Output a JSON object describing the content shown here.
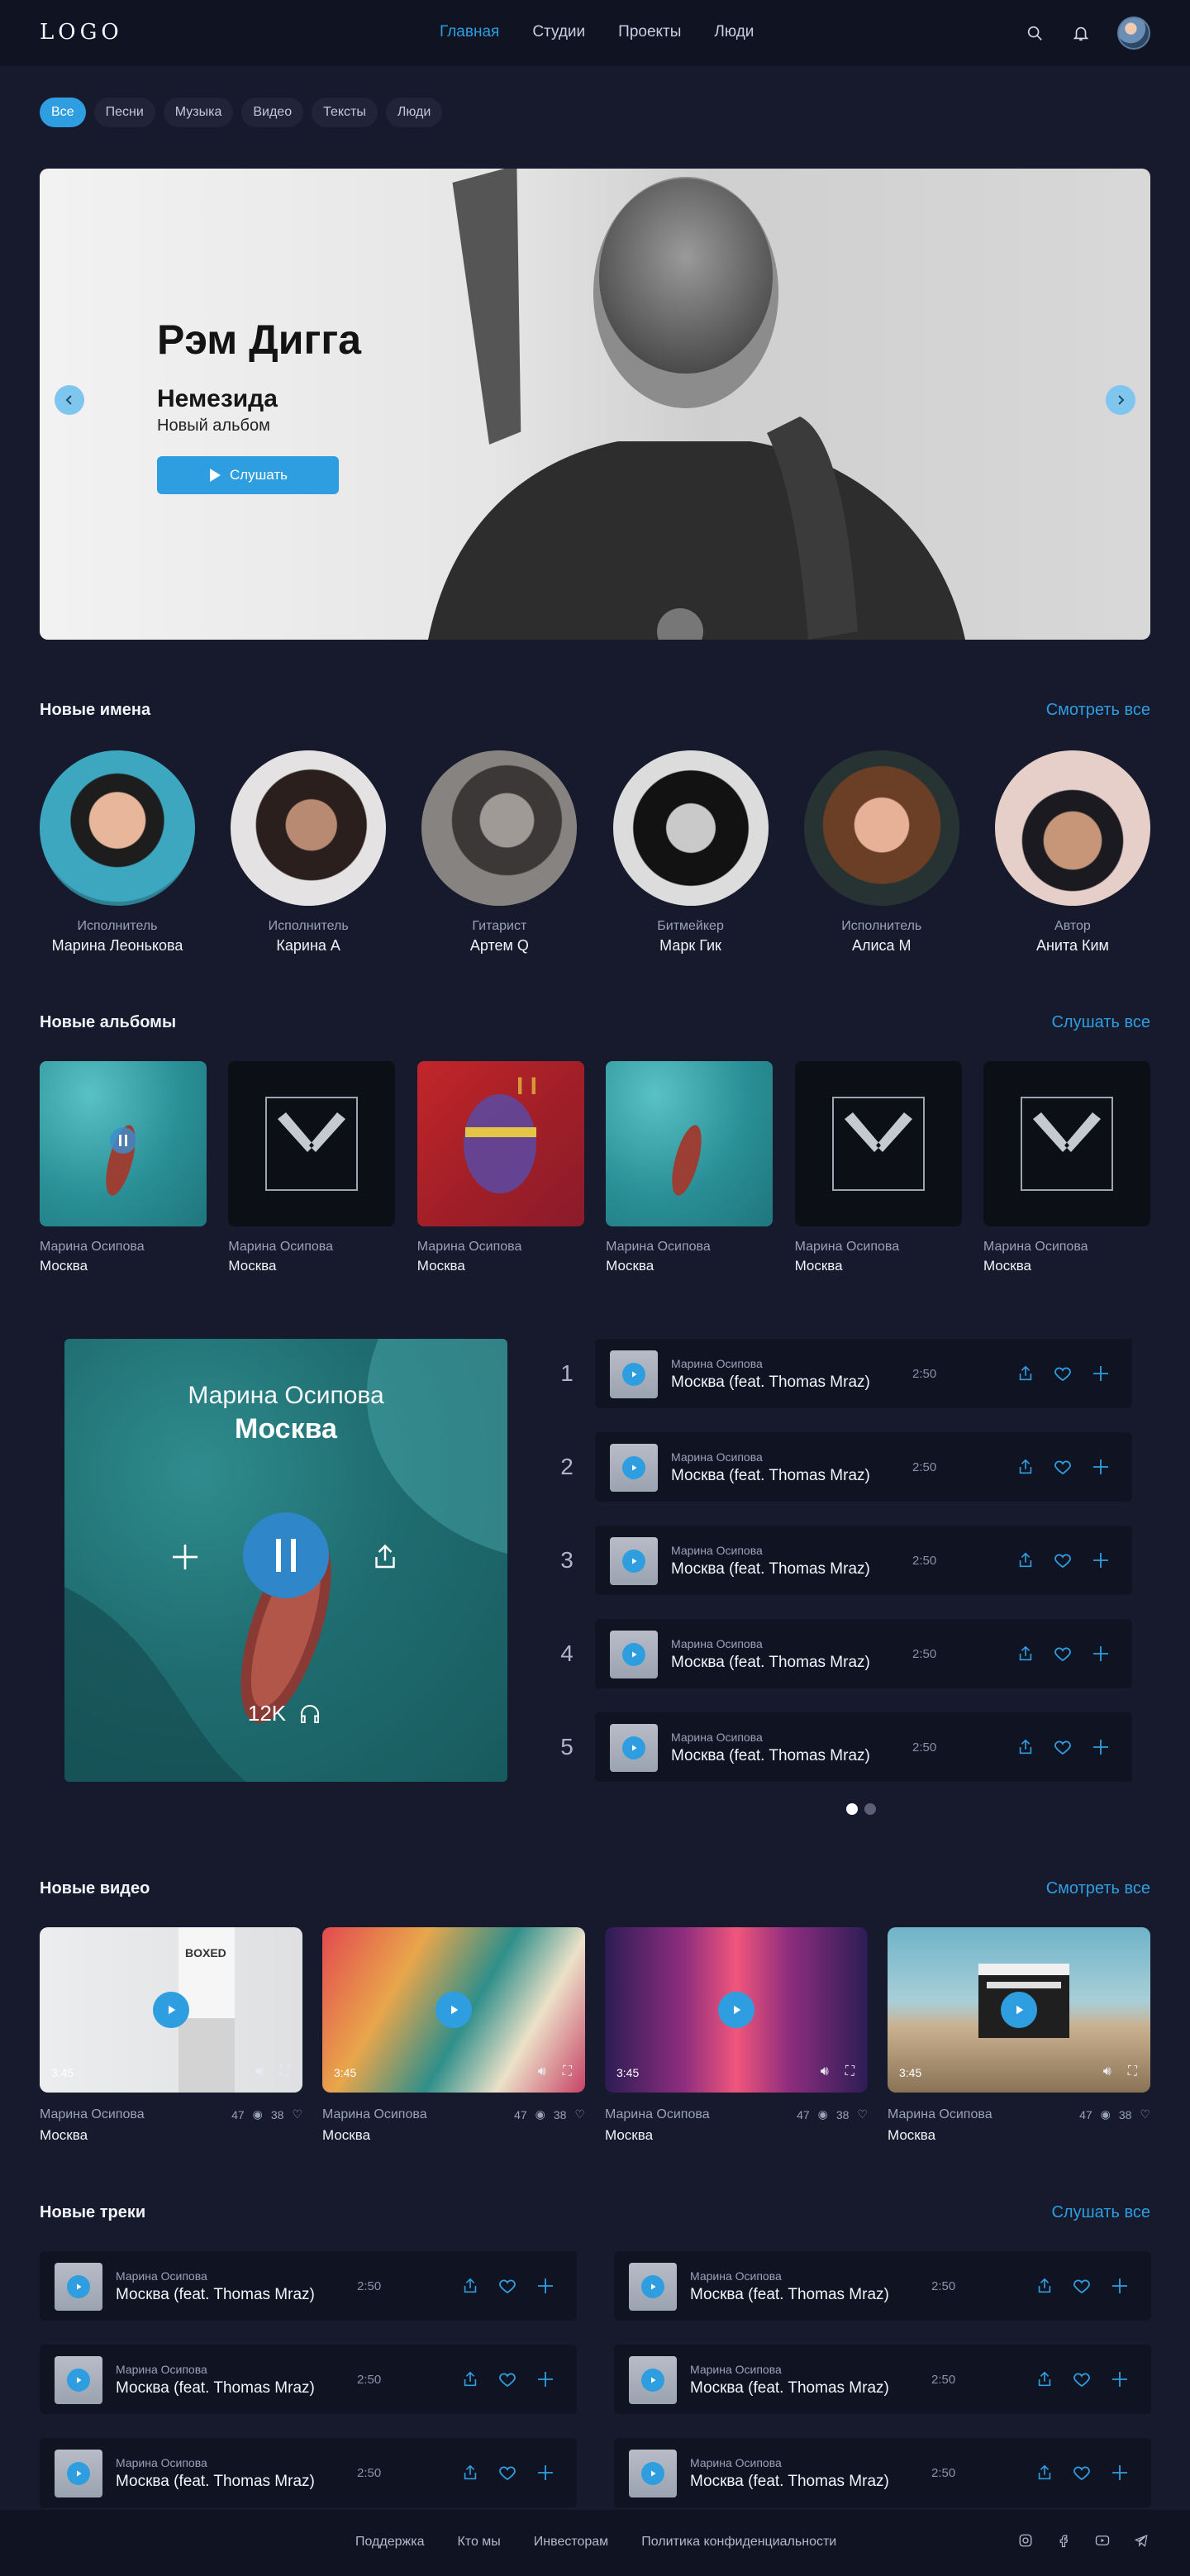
{
  "header": {
    "logo": "LOGO",
    "nav": [
      {
        "label": "Главная",
        "active": true
      },
      {
        "label": "Студии",
        "active": false
      },
      {
        "label": "Проекты",
        "active": false
      },
      {
        "label": "Люди",
        "active": false
      }
    ],
    "icons": [
      "search-icon",
      "bell-icon",
      "avatar"
    ]
  },
  "filters": [
    "Все",
    "Песни",
    "Музыка",
    "Видео",
    "Тексты",
    "Люди"
  ],
  "hero": {
    "artist": "Рэм Дигга",
    "album": "Немезида",
    "subtitle": "Новый альбом",
    "button": "Слушать"
  },
  "new_names": {
    "title": "Новые имена",
    "link": "Смотреть все",
    "artists": [
      {
        "role": "Исполнитель",
        "name": "Марина Леонькова"
      },
      {
        "role": "Исполнитель",
        "name": "Карина А"
      },
      {
        "role": "Гитарист",
        "name": "Артем Q"
      },
      {
        "role": "Битмейкер",
        "name": "Марк Гик"
      },
      {
        "role": "Исполнитель",
        "name": "Алиса М"
      },
      {
        "role": "Автор",
        "name": "Анита Ким"
      }
    ]
  },
  "new_albums": {
    "title": "Новые альбомы",
    "link": "Слушать все",
    "items": [
      {
        "artist": "Марина Осипова",
        "title": "Москва"
      },
      {
        "artist": "Марина Осипова",
        "title": "Москва"
      },
      {
        "artist": "Марина Осипова",
        "title": "Москва"
      },
      {
        "artist": "Марина Осипова",
        "title": "Москва"
      },
      {
        "artist": "Марина Осипова",
        "title": "Москва"
      },
      {
        "artist": "Марина Осипова",
        "title": "Москва"
      }
    ]
  },
  "player": {
    "artist": "Марина Осипова",
    "title": "Москва",
    "listens": "12K"
  },
  "playlist": [
    {
      "num": "1",
      "artist": "Марина Осипова",
      "title": "Москва (feat. Thomas Mraz)",
      "duration": "2:50"
    },
    {
      "num": "2",
      "artist": "Марина Осипова",
      "title": "Москва (feat. Thomas Mraz)",
      "duration": "2:50"
    },
    {
      "num": "3",
      "artist": "Марина Осипова",
      "title": "Москва (feat. Thomas Mraz)",
      "duration": "2:50"
    },
    {
      "num": "4",
      "artist": "Марина Осипова",
      "title": "Москва (feat. Thomas Mraz)",
      "duration": "2:50"
    },
    {
      "num": "5",
      "artist": "Марина Осипова",
      "title": "Москва (feat. Thomas Mraz)",
      "duration": "2:50"
    }
  ],
  "new_videos": {
    "title": "Новые видео",
    "link": "Смотреть все",
    "items": [
      {
        "artist": "Марина Осипова",
        "title": "Москва",
        "time": "3:45",
        "views": "47",
        "likes": "38"
      },
      {
        "artist": "Марина Осипова",
        "title": "Москва",
        "time": "3:45",
        "views": "47",
        "likes": "38"
      },
      {
        "artist": "Марина Осипова",
        "title": "Москва",
        "time": "3:45",
        "views": "47",
        "likes": "38"
      },
      {
        "artist": "Марина Осипова",
        "title": "Москва",
        "time": "3:45",
        "views": "47",
        "likes": "38"
      }
    ]
  },
  "new_tracks": {
    "title": "Новые треки",
    "link": "Слушать все",
    "items": [
      {
        "artist": "Марина Осипова",
        "title": "Москва (feat. Thomas Mraz)",
        "duration": "2:50"
      },
      {
        "artist": "Марина Осипова",
        "title": "Москва (feat. Thomas Mraz)",
        "duration": "2:50"
      },
      {
        "artist": "Марина Осипова",
        "title": "Москва (feat. Thomas Mraz)",
        "duration": "2:50"
      },
      {
        "artist": "Марина Осипова",
        "title": "Москва (feat. Thomas Mraz)",
        "duration": "2:50"
      },
      {
        "artist": "Марина Осипова",
        "title": "Москва (feat. Thomas Mraz)",
        "duration": "2:50"
      },
      {
        "artist": "Марина Осипова",
        "title": "Москва (feat. Thomas Mraz)",
        "duration": "2:50"
      }
    ]
  },
  "footer": {
    "links": [
      "Поддержка",
      "Кто мы",
      "Инвесторам",
      "Политика конфиденциальности"
    ],
    "social": [
      "instagram-icon",
      "facebook-icon",
      "youtube-icon",
      "telegram-icon"
    ]
  },
  "colors": {
    "accent": "#2f9ee0",
    "background": "#161a2c",
    "panel": "#0f1322"
  }
}
